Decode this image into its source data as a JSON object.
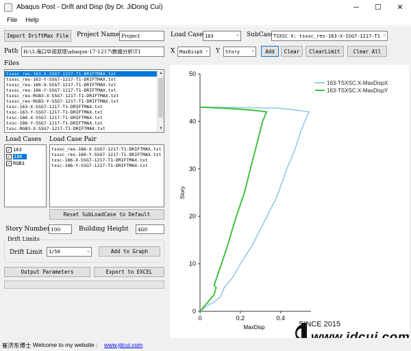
{
  "window": {
    "title": "Abaqus Post - Drift and Disp (by Dr. JiDong Cui)",
    "minimize": "─",
    "maximize": "☐",
    "close": "✕"
  },
  "menu": [
    "File",
    "Help"
  ],
  "toolbar": {
    "import_button": "Import DriftMax File",
    "project_name_label": "Project Name",
    "project_name_value": "Project",
    "load_case_label": "Load Case",
    "load_case_value": "163",
    "subcase_label": "SubCase",
    "subcase_value": "TSXSC X: tsxsc_res-163-X-SSG7-1217-T1-",
    "path_label": "Path",
    "path_value": "H:\\3.海口华润双塔\\abaqus-17-1217\\数据分析\\T1",
    "x_label": "X",
    "x_value": "MaxDispX",
    "y_label": "Y",
    "y_value": "Story",
    "add_button": "Add",
    "clear_button": "Clear",
    "clear_limit_button": "ClearLimit",
    "clear_all_button": "Clear All"
  },
  "files": {
    "label": "Files",
    "items": [
      "tsxsc_res-163-X-SSG7-1217-T1-DRIFTMAX.txt",
      "tsxsc_res-163-Y-SSG7-1217-T1-DRIFTMAX.txt",
      "tsxsc_res-186-X-SSG7-1217-T1-DRIFTMAX.txt",
      "tsxsc_res-186-Y-SSG7-1217-T1-DRIFTMAX.txt",
      "tsxsc_res-RGB3-X-SSG7-1217-T1-DRIFTMAX.txt",
      "tsxsc_res-RGB3-Y-SSG7-1217-T1-DRIFTMAX.txt",
      "txsc-163-X-SSG7-1217-T1-DRIFTMAX.txt",
      "txsc-163-Y-SSG7-1217-T1-DRIFTMAX.txt",
      "txsc-186-X-SSG7-1217-T1-DRIFTMAX.txt",
      "txsc-186-Y-SSG7-1217-T1-DRIFTMAX.txt",
      "txsc-RGB3-X-SSG7-1217-T1-DRIFTMAX.txt"
    ]
  },
  "load_cases": {
    "label": "Load Cases",
    "items": [
      {
        "label": "163",
        "checked": true
      },
      {
        "label": "186",
        "checked": true
      },
      {
        "label": "RGB3",
        "checked": true
      }
    ]
  },
  "load_case_pair": {
    "label": "Load Case Pair",
    "items": [
      "tsxsc_res-186-X-SSG7-1217-T1-DRIFTMAX.txt",
      "tsxsc_res-186-Y-SSG7-1217-T1-DRIFTMAX.txt",
      "txsc-186-X-SSG7-1217-T1-DRIFTMAX.txt",
      "txsc-186-Y-SSG7-1217-T1-DRIFTMAX.txt"
    ]
  },
  "reset_button": "Reset SubLoadCase to Default",
  "story_number_label": "Story Number",
  "story_number_value": "100",
  "building_height_label": "Building Height",
  "building_height_value": "460",
  "drift_limits": {
    "label": "Drift Limits",
    "drift_limit_label": "Drift Limit",
    "drift_limit_value": "1/50",
    "add_to_graph_button": "Add to Graph"
  },
  "output_parameters_button": "Output Parameters",
  "export_excel_button": "Export to EXCEL",
  "status": {
    "author": "崔济东博士",
    "welcome": "Welcome to my website :",
    "link": "www.jdcui.com"
  },
  "watermark": {
    "since": "SINCE 2015",
    "site": "www.jdcui.com"
  },
  "colors": {
    "series_x": "#93c9e8",
    "series_y": "#3cc23c",
    "selection": "#0078d7"
  },
  "chart_data": {
    "type": "line",
    "xlabel": "MaxDisp",
    "ylabel": "Story",
    "xlim": [
      0,
      0.55
    ],
    "ylim": [
      0,
      50
    ],
    "xticks": [
      "0",
      "0.2",
      "0.4"
    ],
    "yticks": [
      "0",
      "10",
      "20",
      "30",
      "40",
      "50"
    ],
    "legend_position": "top-right",
    "series": [
      {
        "name": "163-TSXSC:X-MaxDispX",
        "points": [
          [
            0,
            0
          ],
          [
            0.03,
            1
          ],
          [
            0.07,
            2
          ],
          [
            0.1,
            3
          ],
          [
            0.12,
            5
          ],
          [
            0.16,
            7
          ],
          [
            0.2,
            10
          ],
          [
            0.26,
            14
          ],
          [
            0.32,
            19
          ],
          [
            0.38,
            24
          ],
          [
            0.43,
            30
          ],
          [
            0.47,
            34
          ],
          [
            0.5,
            38
          ],
          [
            0.53,
            41
          ],
          [
            0.54,
            42
          ],
          [
            0.45,
            42.5
          ],
          [
            0.38,
            42.8
          ],
          [
            0.2,
            42.9
          ],
          [
            0.08,
            43
          ],
          [
            0,
            43
          ]
        ]
      },
      {
        "name": "163-TSXSC:X-MaxDispY",
        "points": [
          [
            0,
            0
          ],
          [
            0.02,
            1
          ],
          [
            0.05,
            2.5
          ],
          [
            0.07,
            3.5
          ],
          [
            0.08,
            5
          ],
          [
            0.07,
            5.5
          ],
          [
            0.09,
            8
          ],
          [
            0.13,
            13
          ],
          [
            0.18,
            20
          ],
          [
            0.22,
            25
          ],
          [
            0.25,
            30
          ],
          [
            0.28,
            35
          ],
          [
            0.31,
            40
          ],
          [
            0.33,
            42
          ],
          [
            0.25,
            42.4
          ],
          [
            0.15,
            42.7
          ],
          [
            0.05,
            42.9
          ],
          [
            0,
            43
          ]
        ]
      }
    ]
  }
}
